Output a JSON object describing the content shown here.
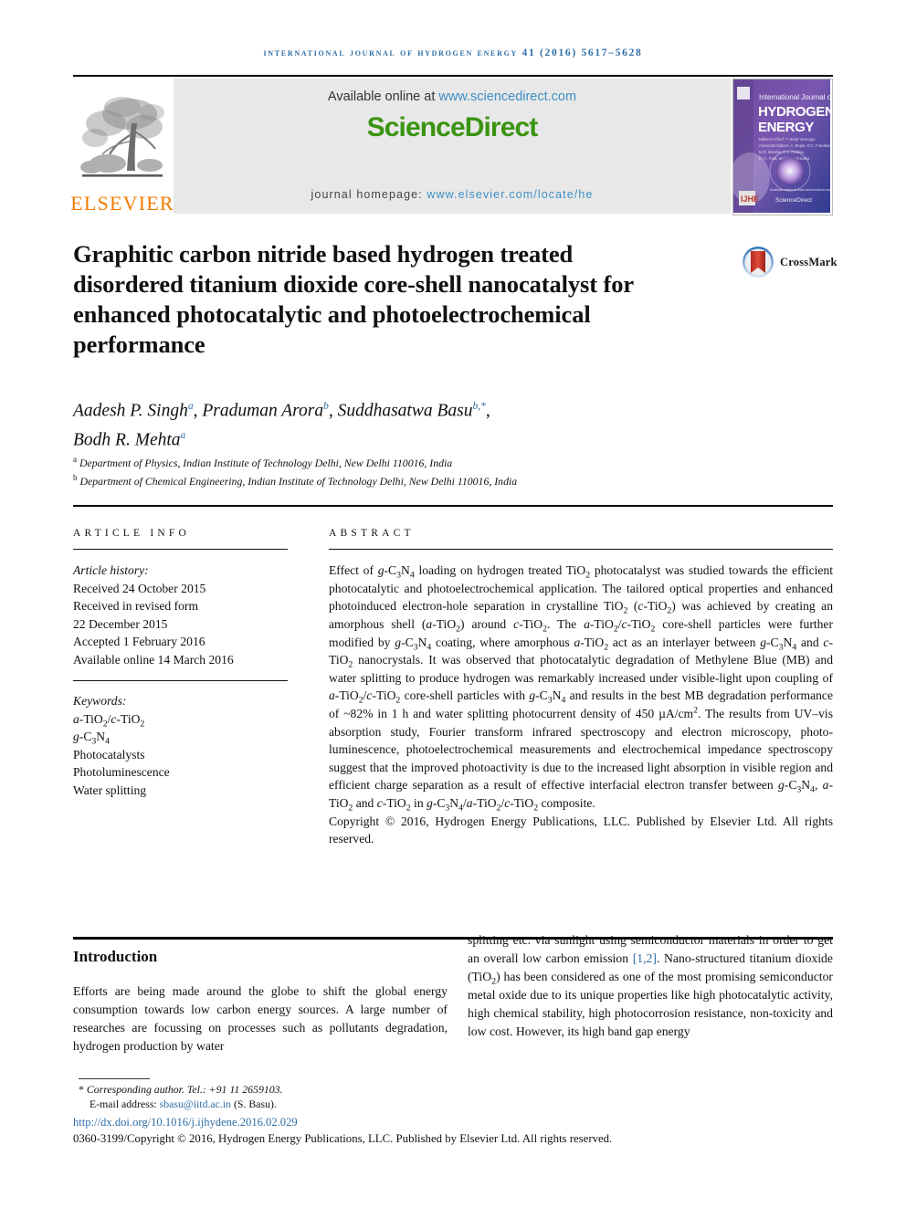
{
  "running_head": "International Journal of Hydrogen Energy 41 (2016) 5617–5628",
  "masthead": {
    "publisher_name": "ELSEVIER",
    "available_prefix": "Available online at ",
    "available_url": "www.sciencedirect.com",
    "sciencedirect_logo": "ScienceDirect",
    "homepage_prefix": "journal homepage: ",
    "homepage_url": "www.elsevier.com/locate/he",
    "cover_title_small": "International Journal of",
    "cover_title_line1": "HYDROGEN",
    "cover_title_line2": "ENERGY",
    "cover_sciencedirect": "ScienceDirect"
  },
  "article": {
    "title": "Graphitic carbon nitride based hydrogen treated disordered titanium dioxide core-shell nanocatalyst for enhanced photocatalytic and photoelectrochemical performance",
    "crossmark_label": "CrossMark",
    "authors_line1_a": "Aadesh P. Singh",
    "authors_sup1": "a",
    "authors_line1_b": ", Praduman Arora",
    "authors_sup2": "b",
    "authors_line1_c": ", Suddhasatwa Basu",
    "authors_sup3": "b,*",
    "authors_line1_d": ",",
    "authors_line2": "Bodh R. Mehta",
    "authors_sup4": "a",
    "affiliation_a_sup": "a",
    "affiliation_a": " Department of Physics, Indian Institute of Technology Delhi, New Delhi 110016, India",
    "affiliation_b_sup": "b",
    "affiliation_b": " Department of Chemical Engineering, Indian Institute of Technology Delhi, New Delhi 110016, India"
  },
  "article_info": {
    "heading": "ARTICLE INFO",
    "history_label": "Article history:",
    "received": "Received 24 October 2015",
    "revised_label": "Received in revised form",
    "revised_date": "22 December 2015",
    "accepted": "Accepted 1 February 2016",
    "available_online": "Available online 14 March 2016",
    "keywords_label": "Keywords:",
    "keywords": [
      "a-TiO2/c-TiO2",
      "g-C3N4",
      "Photocatalysts",
      "Photoluminescence",
      "Water splitting"
    ]
  },
  "abstract": {
    "heading": "ABSTRACT",
    "text": "Effect of g-C3N4 loading on hydrogen treated TiO2 photocatalyst was studied towards the efficient photocatalytic and photoelectrochemical application. The tailored optical properties and enhanced photoinduced electron-hole separation in crystalline TiO2 (c-TiO2) was achieved by creating an amorphous shell (a-TiO2) around c-TiO2. The a-TiO2/c-TiO2 core-shell particles were further modified by g-C3N4 coating, where amorphous a-TiO2 act as an interlayer between g-C3N4 and c-TiO2 nanocrystals. It was observed that photocatalytic degradation of Methylene Blue (MB) and water splitting to produce hydrogen was remarkably increased under visible-light upon coupling of a-TiO2/c-TiO2 core-shell particles with g-C3N4 and results in the best MB degradation performance of ~82% in 1 h and water splitting photocurrent density of 450 μA/cm2. The results from UV–vis absorption study, Fourier transform infrared spectroscopy and electron microscopy, photoluminescence, photoelectrochemical measurements and electrochemical impedance spectroscopy suggest that the improved photoactivity is due to the increased light absorption in visible region and efficient charge separation as a result of effective interfacial electron transfer between g-C3N4, a-TiO2 and c-TiO2 in g-C3N4/a-TiO2/c-TiO2 composite.",
    "copyright": "Copyright © 2016, Hydrogen Energy Publications, LLC. Published by Elsevier Ltd. All rights reserved."
  },
  "introduction": {
    "heading": "Introduction",
    "col_left": "Efforts are being made around the globe to shift the global energy consumption towards low carbon energy sources. A large number of researches are focussing on processes such as pollutants degradation, hydrogen production by water",
    "col_right_part1": "splitting etc. via sunlight using semiconductor materials in order to get an overall low carbon emission ",
    "col_right_ref": "[1,2]",
    "col_right_part2": ". Nano-structured titanium dioxide (TiO2) has been considered as one of the most promising semiconductor metal oxide due to its unique properties like high photocatalytic activity, high chemical stability, high photocorrosion resistance, non-toxicity and low cost. However, its high band gap energy"
  },
  "footer": {
    "corresponding_marker": "*",
    "corresponding_text": " Corresponding author. Tel.: +91 11 2659103.",
    "email_label": "E-mail address: ",
    "email": "sbasu@iitd.ac.in",
    "email_suffix": " (S. Basu).",
    "doi": "http://dx.doi.org/10.1016/j.ijhydene.2016.02.029",
    "issn_line": "0360-3199/Copyright © 2016, Hydrogen Energy Publications, LLC. Published by Elsevier Ltd. All rights reserved."
  },
  "colors": {
    "link_blue": "#2e6da4",
    "sd_green": "#3a9410",
    "elsevier_orange": "#f07c00",
    "homepage_blue": "#3d8fc4"
  }
}
